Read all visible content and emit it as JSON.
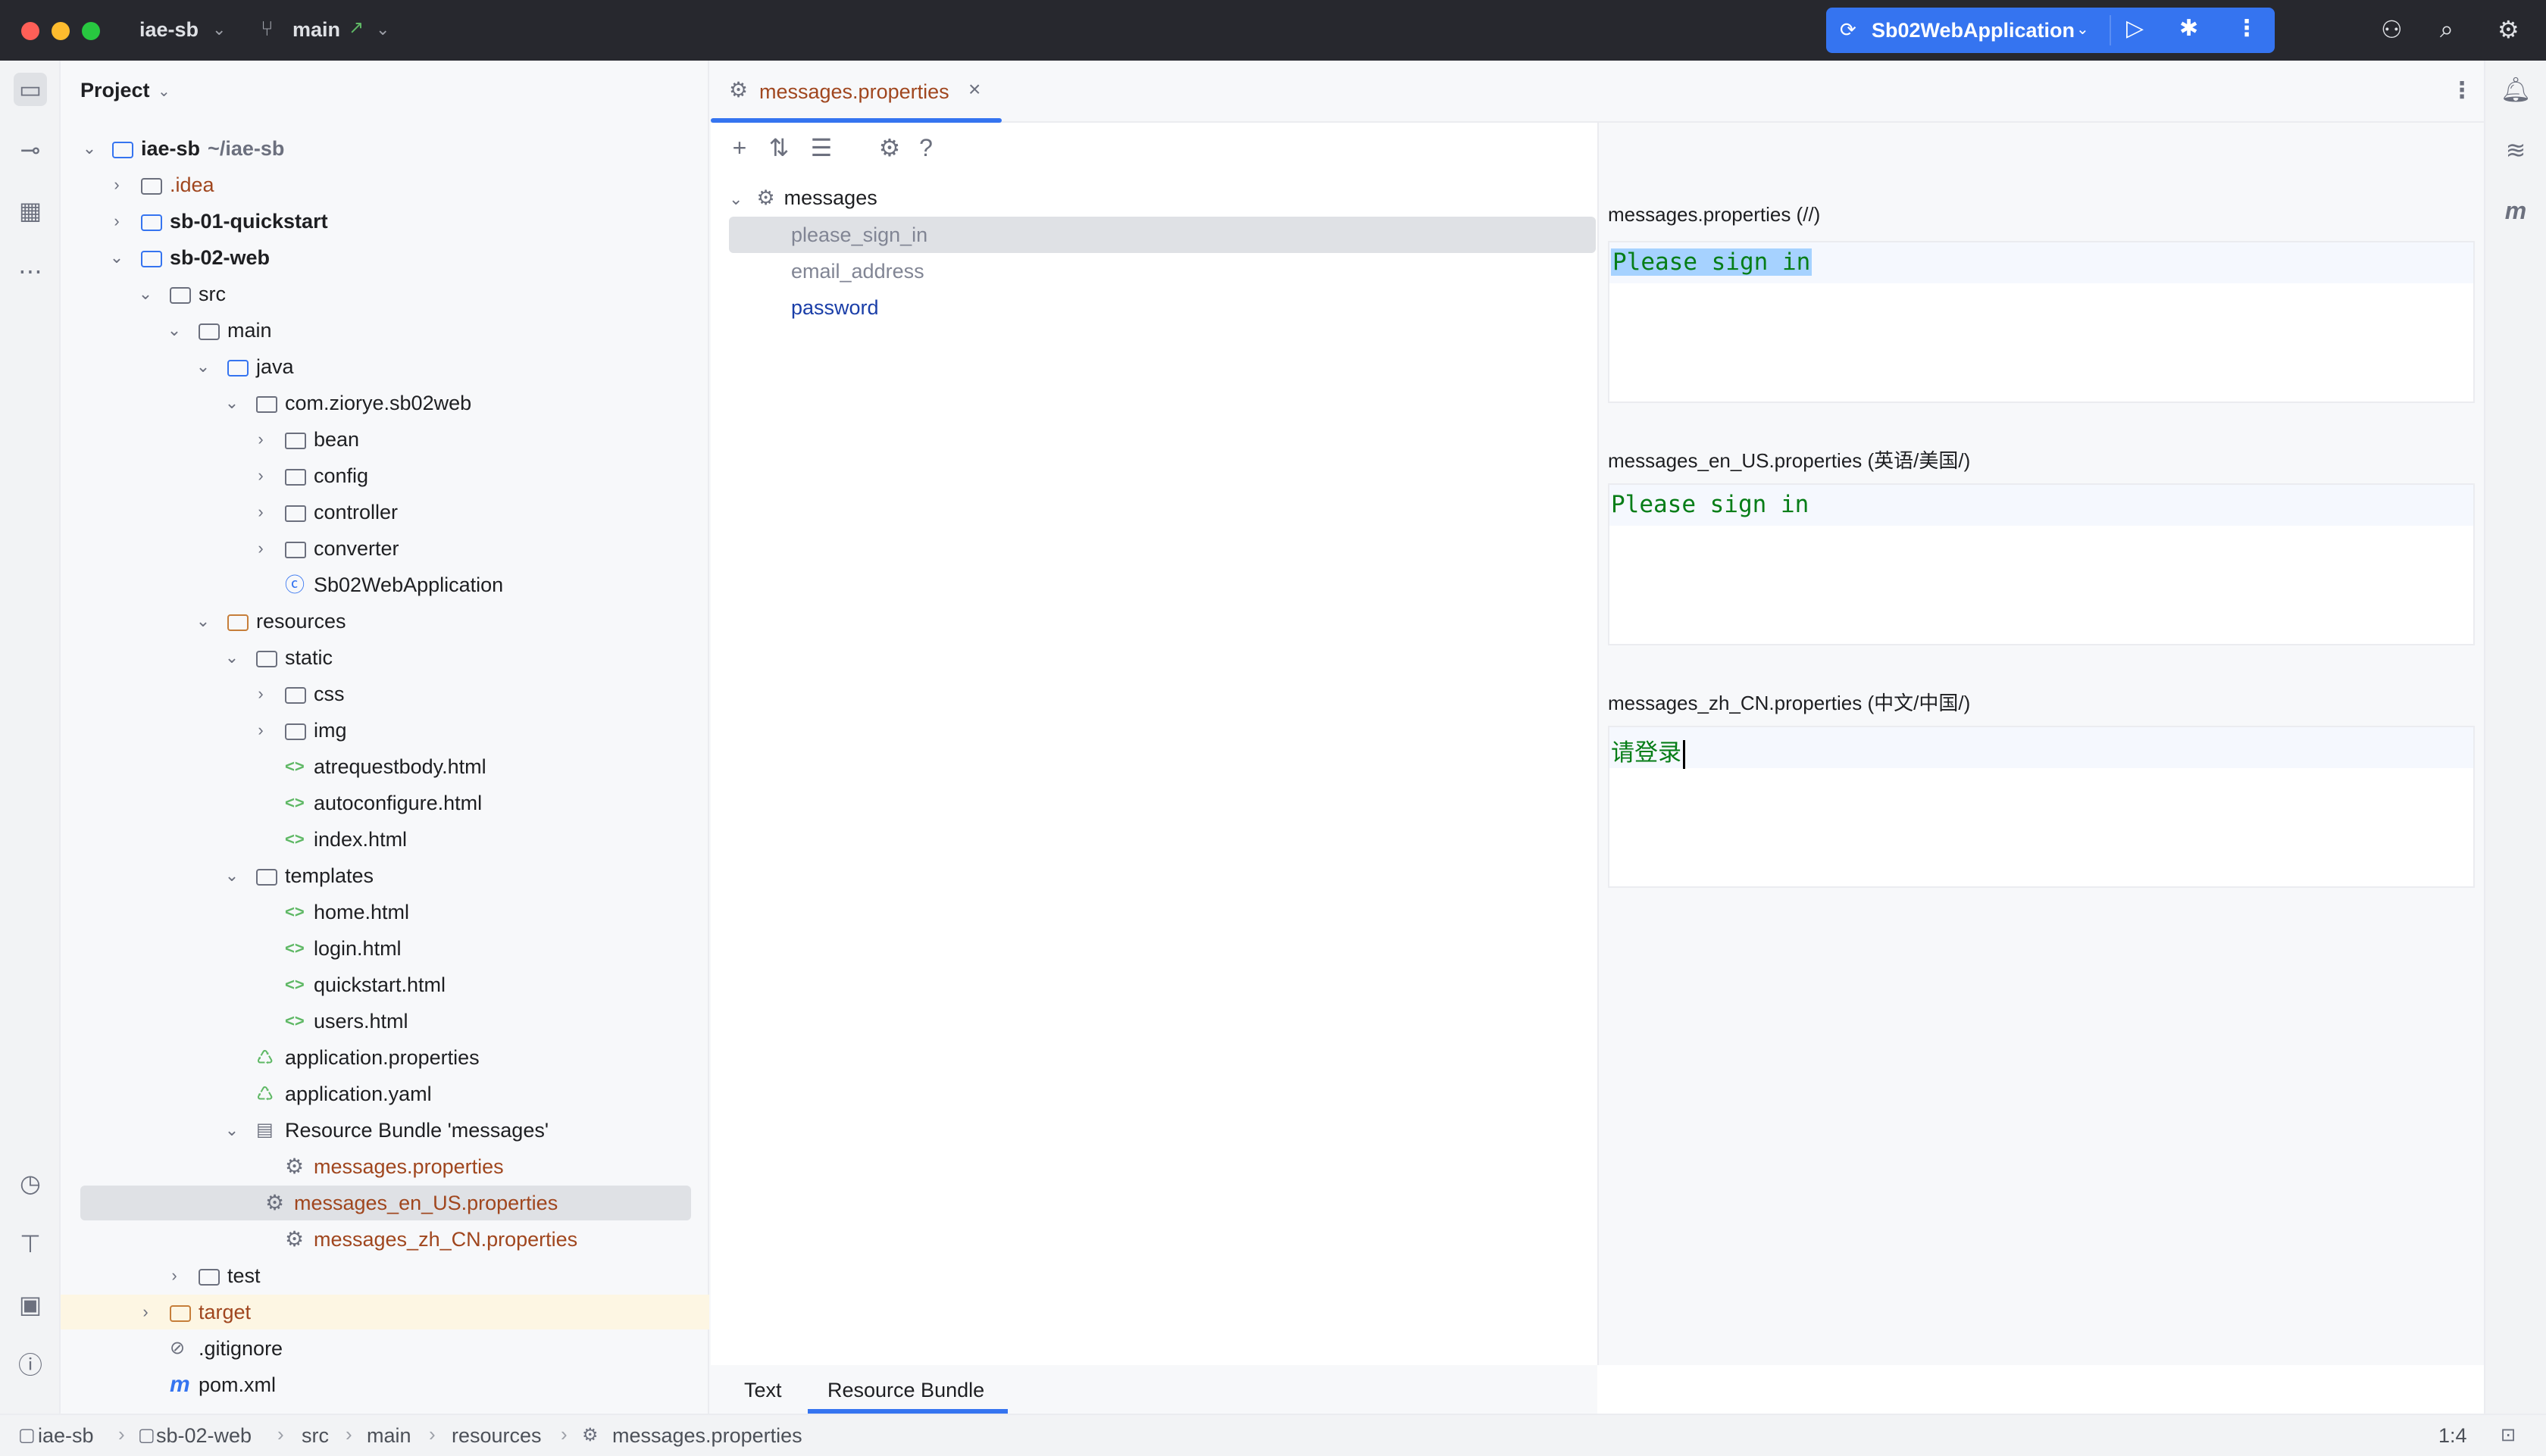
{
  "titlebar": {
    "project_name": "iae-sb",
    "branch": "main",
    "run_config": "Sb02WebApplication"
  },
  "project_panel": {
    "title": "Project",
    "tree": [
      {
        "label": "iae-sb",
        "extra": "~/iae-sb"
      },
      {
        "label": ".idea"
      },
      {
        "label": "sb-01-quickstart"
      },
      {
        "label": "sb-02-web"
      },
      {
        "label": "src"
      },
      {
        "label": "main"
      },
      {
        "label": "java"
      },
      {
        "label": "com.ziorye.sb02web"
      },
      {
        "label": "bean"
      },
      {
        "label": "config"
      },
      {
        "label": "controller"
      },
      {
        "label": "converter"
      },
      {
        "label": "Sb02WebApplication"
      },
      {
        "label": "resources"
      },
      {
        "label": "static"
      },
      {
        "label": "css"
      },
      {
        "label": "img"
      },
      {
        "label": "atrequestbody.html"
      },
      {
        "label": "autoconfigure.html"
      },
      {
        "label": "index.html"
      },
      {
        "label": "templates"
      },
      {
        "label": "home.html"
      },
      {
        "label": "login.html"
      },
      {
        "label": "quickstart.html"
      },
      {
        "label": "users.html"
      },
      {
        "label": "application.properties"
      },
      {
        "label": "application.yaml"
      },
      {
        "label": "Resource Bundle 'messages'"
      },
      {
        "label": "messages.properties"
      },
      {
        "label": "messages_en_US.properties"
      },
      {
        "label": "messages_zh_CN.properties"
      },
      {
        "label": "test"
      },
      {
        "label": "target"
      },
      {
        "label": ".gitignore"
      },
      {
        "label": "pom.xml"
      }
    ]
  },
  "editor": {
    "tab_label": "messages.properties",
    "bundle_tree": {
      "root": "messages",
      "keys": [
        "please_sign_in",
        "email_address",
        "password"
      ]
    },
    "locales": [
      {
        "header": "messages.properties (//)",
        "value": "Please sign in"
      },
      {
        "header": "messages_en_US.properties (英语/美国/)",
        "value": "Please sign in"
      },
      {
        "header": "messages_zh_CN.properties (中文/中国/)",
        "value": "请登录"
      }
    ],
    "bottom_tabs": [
      "Text",
      "Resource Bundle"
    ]
  },
  "statusbar": {
    "breadcrumb": [
      "iae-sb",
      "sb-02-web",
      "src",
      "main",
      "resources",
      "messages.properties"
    ],
    "position": "1:4"
  },
  "colors": {
    "accent": "#3574f0",
    "titlebar_bg": "#27282e",
    "string_green": "#067d17",
    "file_orange": "#a0461e"
  }
}
